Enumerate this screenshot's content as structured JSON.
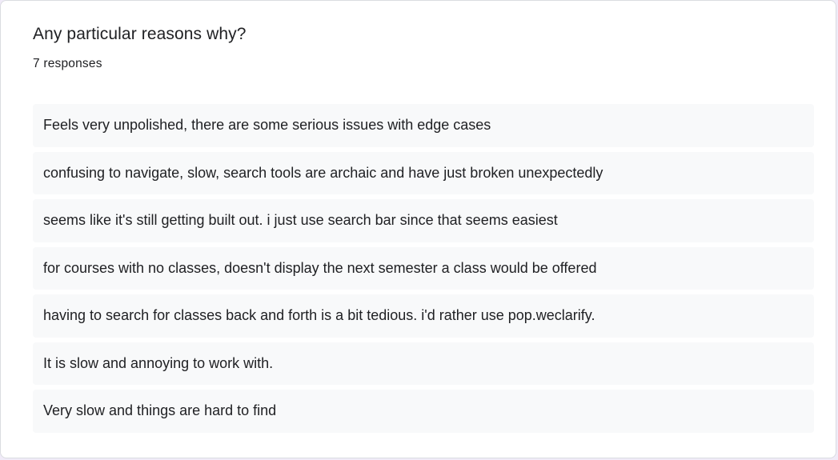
{
  "question": {
    "title": "Any particular reasons why?",
    "response_count": "7 responses"
  },
  "responses": [
    "Feels very unpolished, there are some serious issues with edge cases",
    "confusing to navigate, slow, search tools are archaic and have just broken unexpectedly",
    "seems like it's still getting built out. i just use search bar since that seems easiest",
    "for courses with no classes, doesn't display the next semester a class would be offered",
    "having to search for classes back and forth is a bit tedious. i'd rather use pop.weclarify.",
    "It is slow and annoying to work with.",
    "Very slow and things are hard to find"
  ],
  "colors": {
    "card_background": "#ffffff",
    "response_background": "#f8f9fa",
    "text": "#202124",
    "border": "#dadce0"
  }
}
